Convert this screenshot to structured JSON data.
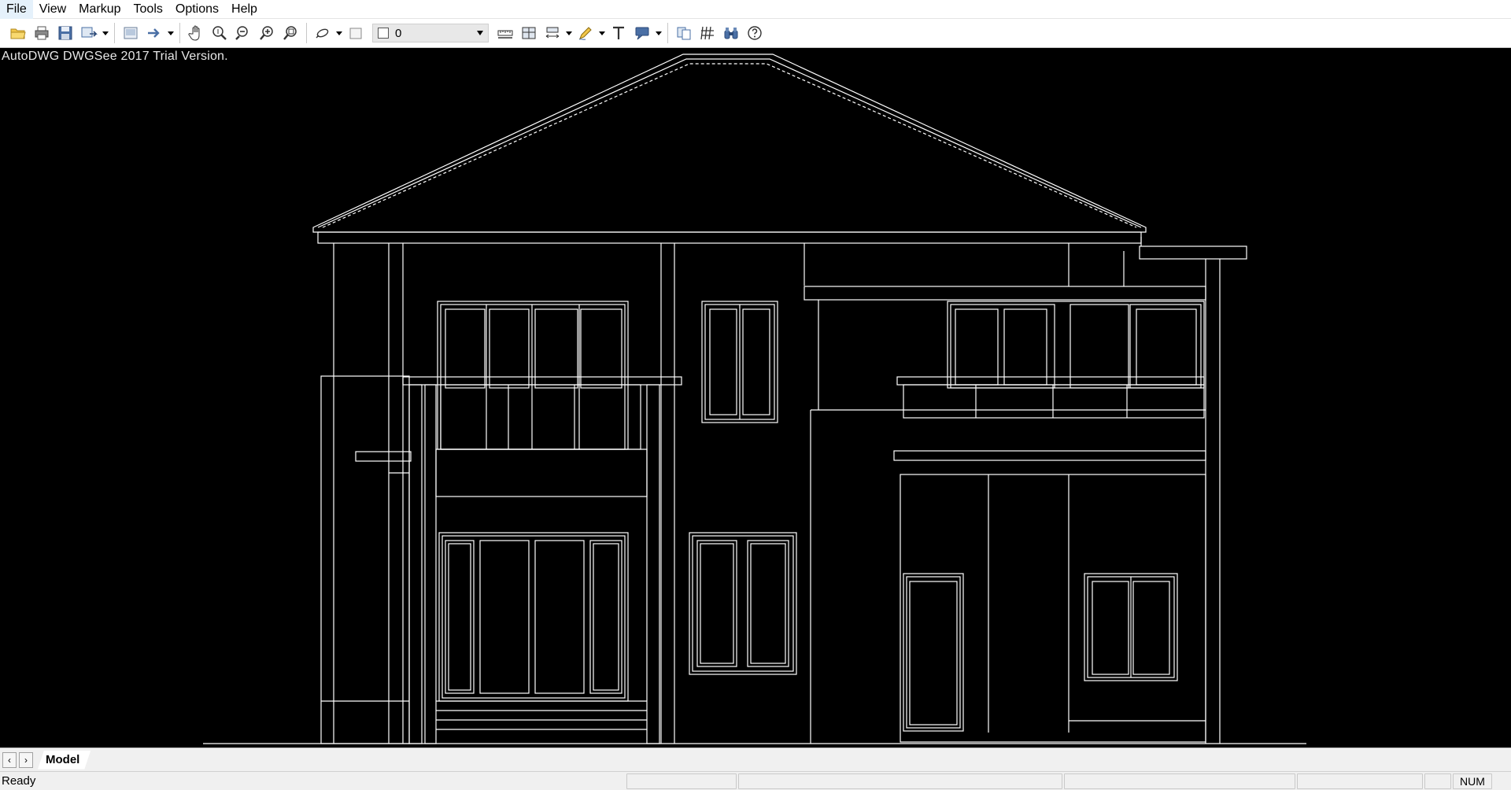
{
  "menubar": {
    "items": [
      "File",
      "View",
      "Markup",
      "Tools",
      "Options",
      "Help"
    ]
  },
  "toolbar": {
    "layer_value": "0",
    "icons": [
      "open-folder-icon",
      "print-icon",
      "save-icon",
      "export-icon",
      "layout-icon",
      "arrow-right-icon",
      "pan-hand-icon",
      "zoom-realtime-icon",
      "zoom-out-icon",
      "zoom-in-icon",
      "zoom-window-icon",
      "layer-icon",
      "layer-state-icon",
      "ruler-icon",
      "area-measure-icon",
      "dimension-icon",
      "pen-icon",
      "text-icon",
      "callout-icon",
      "compare-icon",
      "hatch-icon",
      "binoculars-icon",
      "help-icon"
    ]
  },
  "canvas": {
    "watermark": "AutoDWG DWGSee 2017 Trial Version.",
    "background": "#000000",
    "line_color": "#ffffff"
  },
  "tabs": {
    "active": "Model"
  },
  "status": {
    "text": "Ready",
    "num": "NUM"
  }
}
